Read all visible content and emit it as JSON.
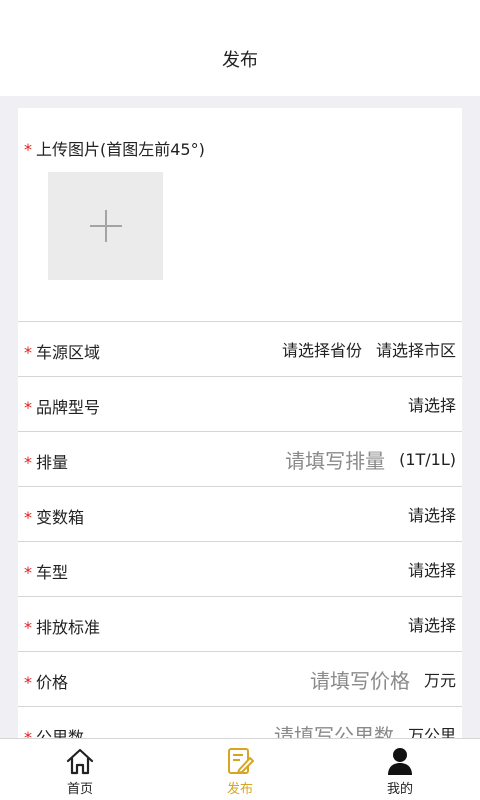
{
  "header": {
    "title": "发布"
  },
  "upload": {
    "required_mark": "*",
    "label": "上传图片(首图左前45°)"
  },
  "rows": [
    {
      "required_mark": "*",
      "label": "车源区域",
      "province": "请选择省份",
      "city": "请选择市区"
    },
    {
      "required_mark": "*",
      "label": "品牌型号",
      "value": "请选择"
    },
    {
      "required_mark": "*",
      "label": "排量",
      "placeholder": "请填写排量",
      "unit": "(1T/1L)"
    },
    {
      "required_mark": "*",
      "label": "变数箱",
      "value": "请选择"
    },
    {
      "required_mark": "*",
      "label": "车型",
      "value": "请选择"
    },
    {
      "required_mark": "*",
      "label": "排放标准",
      "value": "请选择"
    },
    {
      "required_mark": "*",
      "label": "价格",
      "placeholder": "请填写价格",
      "unit": "万元"
    },
    {
      "required_mark": "*",
      "label": "公里数",
      "placeholder": "请填写公里数",
      "unit": "万公里"
    }
  ],
  "tabbar": {
    "active_color": "#d8a520",
    "items": [
      {
        "label": "首页",
        "icon": "home-icon"
      },
      {
        "label": "发布",
        "icon": "edit-icon"
      },
      {
        "label": "我的",
        "icon": "user-icon"
      }
    ]
  }
}
